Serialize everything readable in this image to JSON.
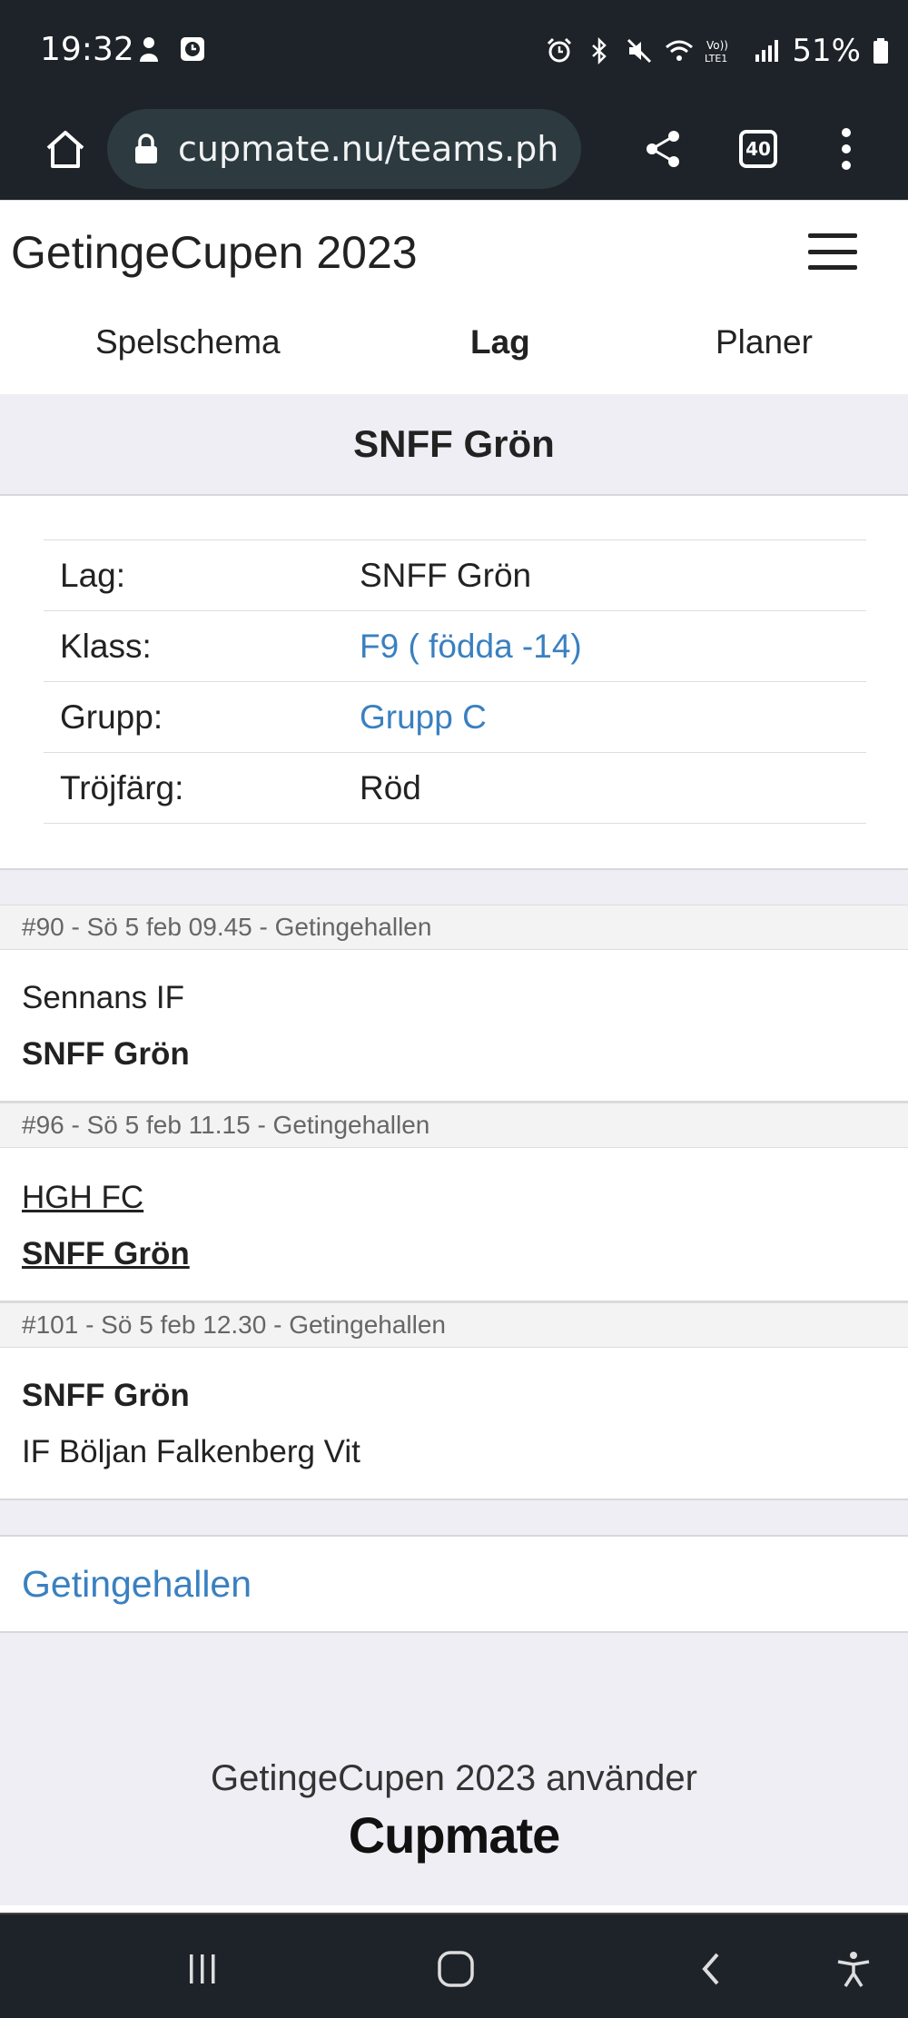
{
  "status_bar": {
    "time": "19:32",
    "battery": "51%",
    "icons": [
      "person-icon",
      "clock-app-icon",
      "alarm-icon",
      "bluetooth-icon",
      "mute-icon",
      "wifi-icon",
      "volte-icon",
      "signal-icon",
      "battery-icon"
    ]
  },
  "browser": {
    "url": "cupmate.nu/teams.ph",
    "tab_count": "40"
  },
  "site": {
    "title": "GetingeCupen 2023"
  },
  "nav_tabs": [
    {
      "label": "Spelschema"
    },
    {
      "label": "Lag"
    },
    {
      "label": "Planer"
    }
  ],
  "team": {
    "name": "SNFF Grön",
    "info": [
      {
        "label": "Lag:",
        "value": "SNFF Grön"
      },
      {
        "label": "Klass:",
        "value": "F9 ( födda -14)"
      },
      {
        "label": "Grupp:",
        "value": "Grupp C"
      },
      {
        "label": "Tröjfärg:",
        "value": "Röd"
      }
    ]
  },
  "matches": [
    {
      "header": "#90 - Sö 5 feb 09.45 - Getingehallen",
      "team1": "Sennans IF",
      "team2": "SNFF Grön"
    },
    {
      "header": "#96 - Sö 5 feb 11.15 - Getingehallen",
      "team1": "HGH FC",
      "team2": "SNFF Grön"
    },
    {
      "header": "#101 - Sö 5 feb 12.30 - Getingehallen",
      "team1": "SNFF Grön",
      "team2": "IF Böljan Falkenberg Vit"
    }
  ],
  "venue": "Getingehallen",
  "footer": {
    "uses_text": "GetingeCupen 2023 använder",
    "logo_text": "Cupmate"
  },
  "colors": {
    "link": "#3a80c0",
    "system_bar": "#1e2329",
    "panel": "#efeef4"
  }
}
